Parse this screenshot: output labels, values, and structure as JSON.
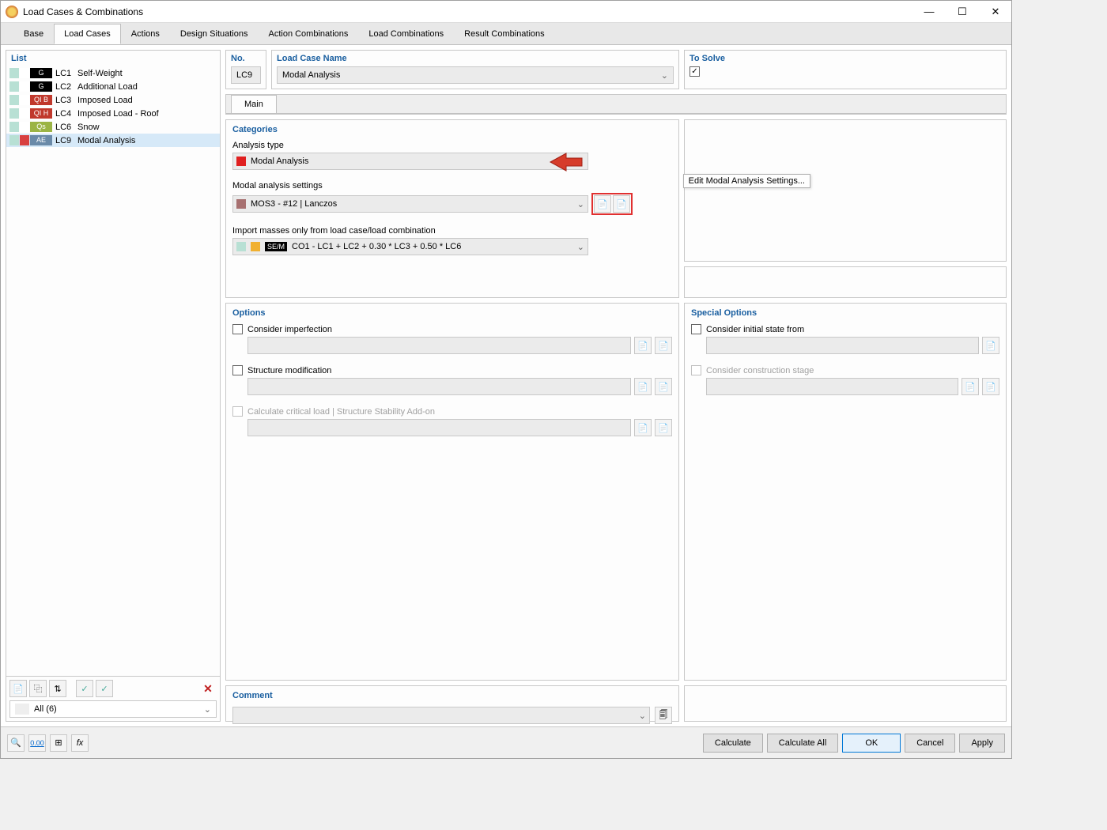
{
  "window": {
    "title": "Load Cases & Combinations"
  },
  "tabs": {
    "base": "Base",
    "load_cases": "Load Cases",
    "actions": "Actions",
    "design_situations": "Design Situations",
    "action_combinations": "Action Combinations",
    "load_combinations": "Load Combinations",
    "result_combinations": "Result Combinations"
  },
  "list": {
    "header": "List",
    "items": [
      {
        "tag_class": "black",
        "tag": "G",
        "code": "LC1",
        "name": "Self-Weight"
      },
      {
        "tag_class": "black",
        "tag": "G",
        "code": "LC2",
        "name": "Additional Load"
      },
      {
        "tag_class": "red",
        "tag": "QI B",
        "code": "LC3",
        "name": "Imposed Load"
      },
      {
        "tag_class": "red",
        "tag": "QI H",
        "code": "LC4",
        "name": "Imposed Load - Roof"
      },
      {
        "tag_class": "green",
        "tag": "Qs",
        "code": "LC6",
        "name": "Snow"
      },
      {
        "tag_class": "blue",
        "tag": "AE",
        "code": "LC9",
        "name": "Modal Analysis"
      }
    ],
    "selected_index": 5,
    "filter": "All (6)"
  },
  "header_fields": {
    "no_label": "No.",
    "no_value": "LC9",
    "name_label": "Load Case Name",
    "name_value": "Modal Analysis",
    "solve_label": "To Solve"
  },
  "sub_tab": "Main",
  "categories": {
    "header": "Categories",
    "analysis_type_label": "Analysis type",
    "analysis_type_value": "Modal Analysis",
    "modal_settings_label": "Modal analysis settings",
    "modal_settings_value": "MOS3 - #12 | Lanczos",
    "tooltip": "Edit Modal Analysis Settings...",
    "import_label": "Import masses only from load case/load combination",
    "import_badge": "SE/M",
    "import_value": "CO1 - LC1 + LC2 + 0.30 * LC3 + 0.50 * LC6"
  },
  "options": {
    "header": "Options",
    "consider_imperfection": "Consider imperfection",
    "structure_modification": "Structure modification",
    "calc_critical": "Calculate critical load | Structure Stability Add-on"
  },
  "special": {
    "header": "Special Options",
    "initial_state": "Consider initial state from",
    "construction_stage": "Consider construction stage"
  },
  "comment": {
    "header": "Comment"
  },
  "buttons": {
    "calculate": "Calculate",
    "calculate_all": "Calculate All",
    "ok": "OK",
    "cancel": "Cancel",
    "apply": "Apply"
  }
}
